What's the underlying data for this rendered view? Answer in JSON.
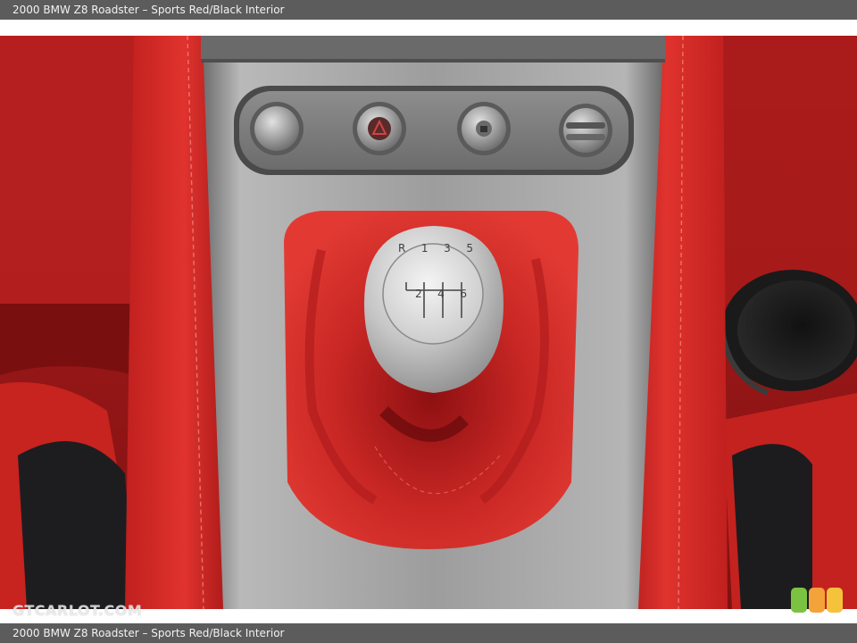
{
  "caption": {
    "top": "2000 BMW Z8 Roadster – Sports Red/Black Interior",
    "bottom": "2000 BMW Z8 Roadster – Sports Red/Black Interior"
  },
  "photo": {
    "watermark": "GTCARLOT.COM",
    "knob_pattern": {
      "top_row": [
        "R",
        "1",
        "3",
        "5"
      ],
      "bottom_row": [
        "2",
        "4",
        "6"
      ]
    },
    "colors": {
      "leather": "#d42a26",
      "leather_dark": "#a8171a",
      "metal": "#9a9a9a",
      "black_leather": "#1c1c1e"
    }
  },
  "badge": {
    "colors": [
      "#7cc242",
      "#f4a23a",
      "#f5c23c"
    ]
  }
}
